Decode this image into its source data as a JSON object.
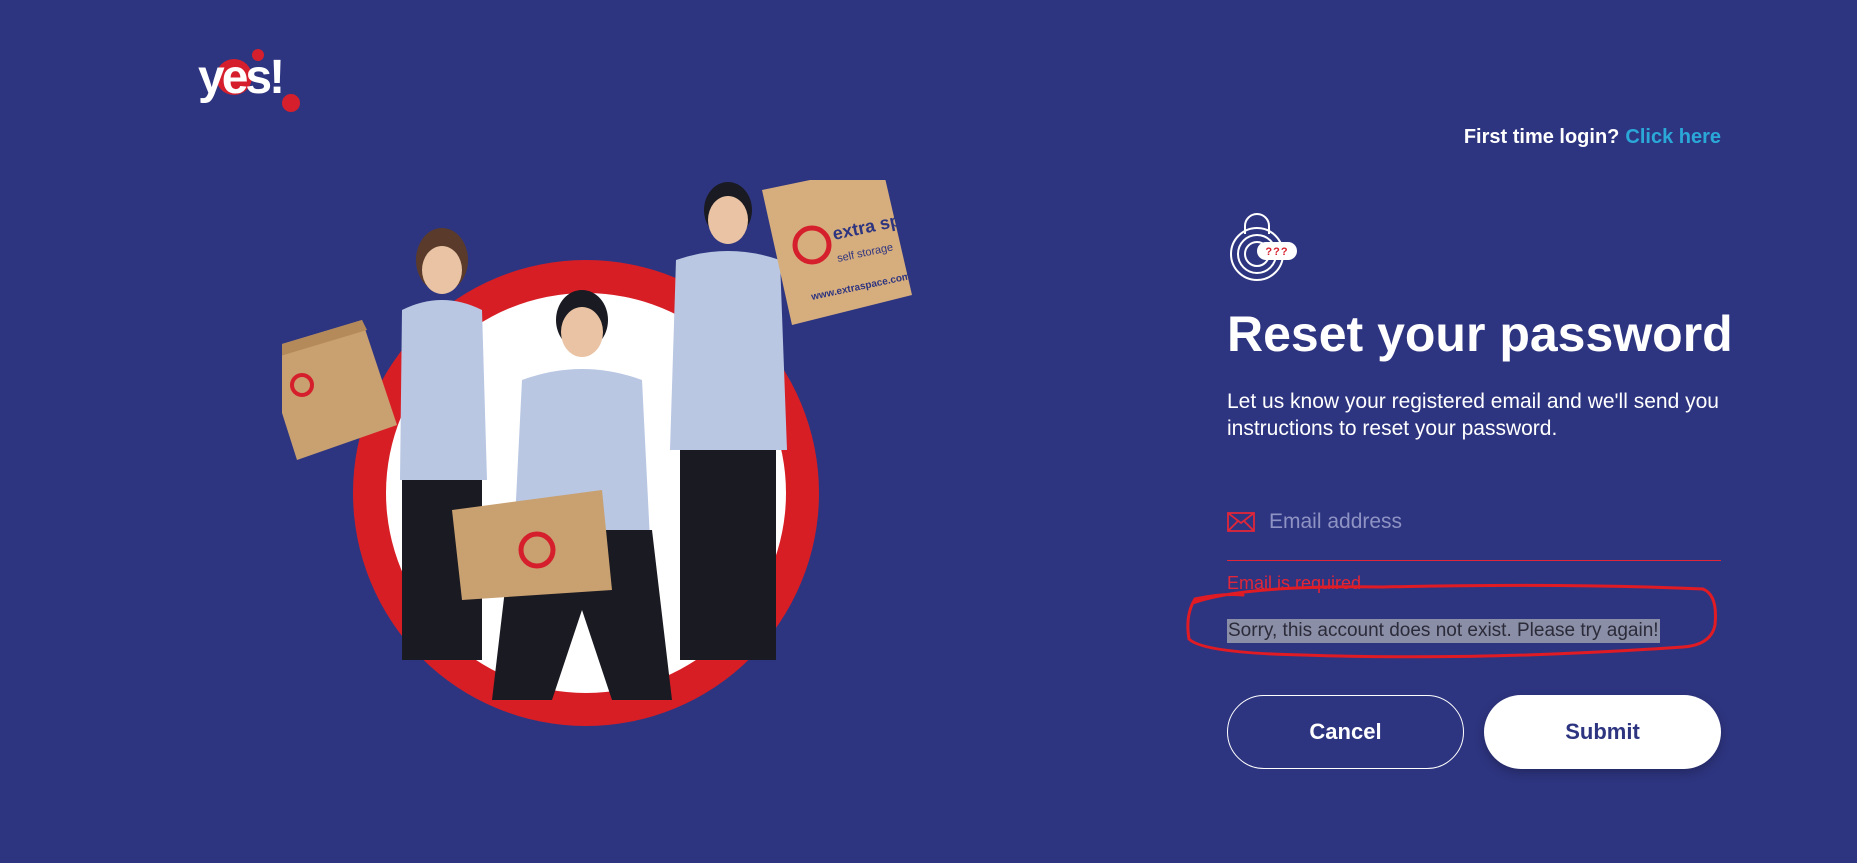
{
  "brand": {
    "logo_text": "yes!",
    "logo_color": "#d61f2c"
  },
  "header": {
    "first_time_label": "First time login?",
    "first_time_link": "Click here"
  },
  "hero": {
    "image_name": "staff-with-boxes-image",
    "box_brand": "extra space",
    "box_sub": "self storage",
    "box_url": "www.extraspace.com.sg"
  },
  "form": {
    "lock_badge": "???",
    "title": "Reset your password",
    "description": "Let us know your registered email and we'll send you instructions to reset your password.",
    "email_placeholder": "Email address",
    "email_value": "",
    "error_required": "Email is required",
    "error_account": "Sorry, this account does not exist. Please try again!",
    "cancel_label": "Cancel",
    "submit_label": "Submit"
  },
  "colors": {
    "background": "#2e3580",
    "accent_red": "#e02638",
    "link": "#2aa8d8",
    "white": "#ffffff"
  }
}
